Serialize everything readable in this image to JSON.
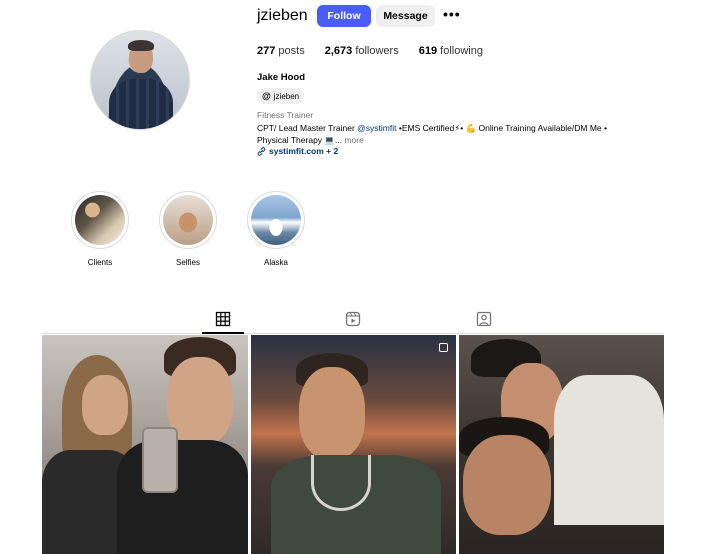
{
  "profile": {
    "username": "jzieben",
    "follow_label": "Follow",
    "message_label": "Message",
    "more_label": "•••",
    "stats": {
      "posts_count": "277",
      "posts_label": "posts",
      "followers_count": "2,673",
      "followers_label": "followers",
      "following_count": "619",
      "following_label": "following"
    },
    "full_name": "Jake Hood",
    "threads_handle": "jzieben",
    "category": "Fitness Trainer",
    "bio_line1_prefix": "CPT/ Lead Master Trainer ",
    "bio_mention": "@systimfit",
    "bio_line1_suffix": " •EMS Certified⚡• 💪 Online Training Available/DM Me •",
    "bio_line2": "Physical Therapy 💻...",
    "bio_more": "more",
    "link_text": "systimfit.com + 2"
  },
  "highlights": [
    {
      "label": "Clients"
    },
    {
      "label": "Selfies"
    },
    {
      "label": "Alaska"
    }
  ],
  "tabs": {
    "posts_icon": "grid-icon",
    "reels_icon": "reels-icon",
    "tagged_icon": "tagged-icon",
    "active": "posts"
  },
  "colors": {
    "follow_button": "#4a5df9",
    "message_button": "#efefef",
    "link": "#00376b",
    "muted": "#737373"
  }
}
